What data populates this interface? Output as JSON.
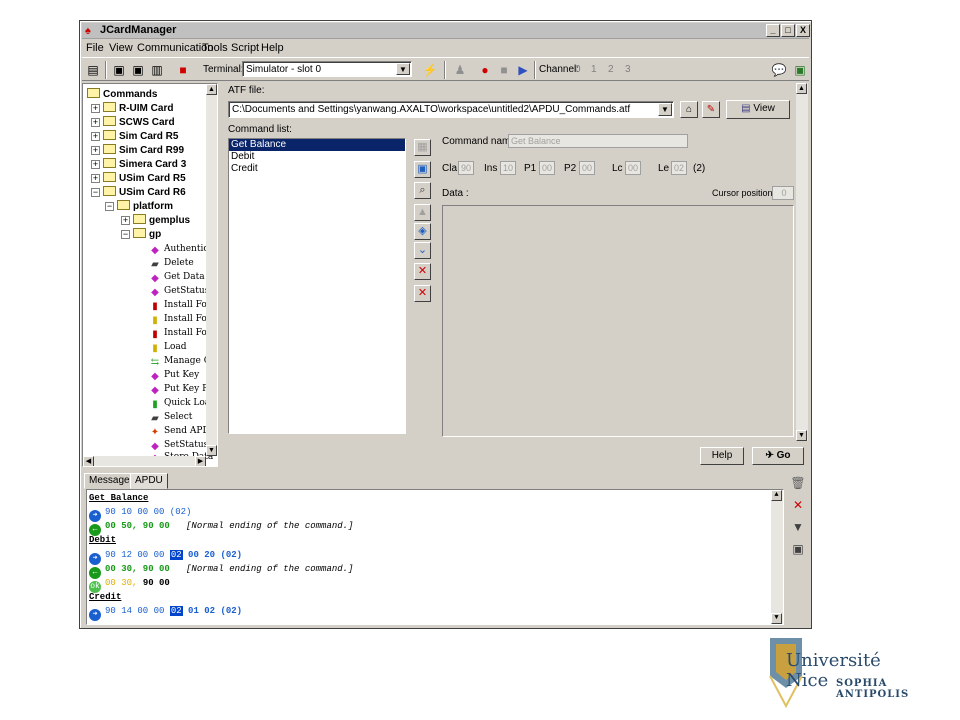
{
  "window": {
    "title": "JCardManager",
    "buttons": [
      "_",
      "□",
      "X"
    ]
  },
  "menu": [
    "File",
    "View",
    "Communication",
    "Tools",
    "Script",
    "Help"
  ],
  "toolbar": {
    "terminal_label": "Terminal:",
    "terminal_value": "Simulator - slot 0",
    "channel_label": "Channel:",
    "channels": [
      "0",
      "1",
      "2",
      "3"
    ]
  },
  "tree": {
    "root": "Commands",
    "cards": [
      "R-UIM Card",
      "SCWS Card",
      "Sim Card R5",
      "Sim Card R99",
      "Simera Card 3",
      "USim Card R5",
      "USim Card R6"
    ],
    "platform": "platform",
    "gemplus": "gemplus",
    "gp": "gp",
    "gp_items": [
      "Authenticat",
      "Delete",
      "Get Data",
      "GetStatus",
      "Install For I",
      "Install For I",
      "Install For I",
      "Load",
      "Manage Ch",
      "Put Key",
      "Put Key RS.",
      "Quick Load",
      "Select",
      "Send APDU",
      "SetStatus",
      "Store Data"
    ]
  },
  "atf": {
    "label": "ATF file:",
    "path": "C:\\Documents and Settings\\yanwang.AXALTO\\workspace\\untitled2\\APDU_Commands.atf",
    "view_button": "View"
  },
  "command_list": {
    "label": "Command list:",
    "items": [
      "Get Balance",
      "Debit",
      "Credit"
    ],
    "selected": "Get Balance"
  },
  "command": {
    "name_label": "Command name",
    "name_value": "Get Balance",
    "cla_label": "Cla",
    "cla": "90",
    "ins_label": "Ins",
    "ins": "10",
    "p1_label": "P1",
    "p1": "00",
    "p2_label": "P2",
    "p2": "00",
    "lc_label": "Lc",
    "lc": "00",
    "le_label": "Le",
    "le": "02",
    "le_extra": "(2)",
    "data_label": "Data :",
    "cursor_label": "Cursor position:",
    "cursor_value": "0"
  },
  "buttons": {
    "help": "Help",
    "go": "Go"
  },
  "tabs": [
    "Messages",
    "APDU"
  ],
  "log": {
    "get_balance": "Get Balance",
    "gb_cmd": "90 10 00 00 (02)",
    "gb_resp": "00 50, 90 00",
    "gb_note": "[Normal ending of the command.]",
    "debit": "Debit",
    "d_cmd_a": "90 12 00 00",
    "d_cmd_hl": "02",
    "d_cmd_b": "00 20 (02)",
    "d_resp": "00 30, 90 00",
    "d_note": "[Normal ending of the command.]",
    "d_ok_a": "00 30,",
    "d_ok_b": "90 00",
    "credit": "Credit",
    "c_cmd_a": "90 14 00 00",
    "c_cmd_hl": "02",
    "c_cmd_b": "01 02 (02)"
  },
  "logo": {
    "line1": "Université",
    "line2": "Nice",
    "line3": "SOPHIA ANTIPOLIS"
  },
  "colors": {
    "selection": "#0a246a",
    "cmd_blue": "#1a5fd0",
    "resp_green": "#1a9a1a",
    "warn_yellow": "#e0b000"
  }
}
